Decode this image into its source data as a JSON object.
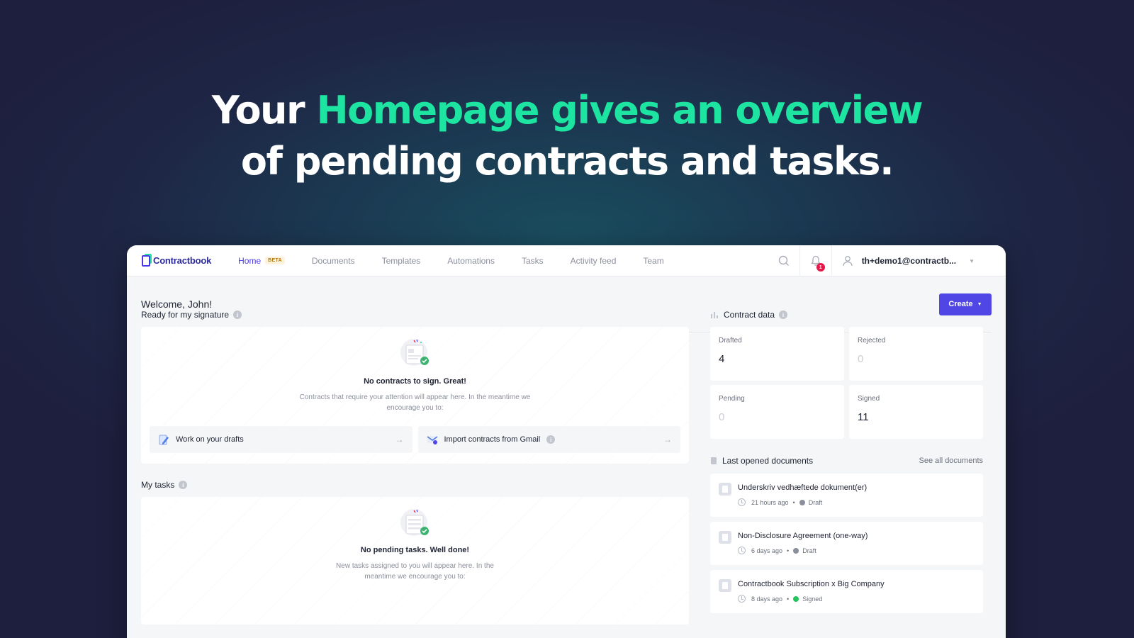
{
  "hero": {
    "line1_prefix": "Your ",
    "line1_accent": "Homepage gives an overview",
    "line2": "of pending contracts and tasks."
  },
  "navbar": {
    "logo": "Contractbook",
    "items": [
      {
        "label": "Home",
        "badge": "BETA",
        "active": true
      },
      {
        "label": "Documents"
      },
      {
        "label": "Templates"
      },
      {
        "label": "Automations"
      },
      {
        "label": "Tasks"
      },
      {
        "label": "Activity feed"
      },
      {
        "label": "Team"
      }
    ],
    "notification_count": "1",
    "user_email": "th+demo1@contractb..."
  },
  "header": {
    "welcome": "Welcome, John!",
    "create_label": "Create"
  },
  "signature": {
    "title": "Ready for my signature",
    "empty_title": "No contracts to sign. Great!",
    "empty_desc": "Contracts that require your attention will appear here. In the meantime we encourage you to:",
    "actions": [
      {
        "label": "Work on your drafts"
      },
      {
        "label": "Import contracts from Gmail"
      }
    ]
  },
  "tasks": {
    "title": "My tasks",
    "empty_title": "No pending tasks. Well done!",
    "empty_desc": "New tasks assigned to you will appear here. In the meantime we encourage you to:"
  },
  "contract_data": {
    "title": "Contract data",
    "stats": [
      {
        "label": "Drafted",
        "value": "4"
      },
      {
        "label": "Rejected",
        "value": "0"
      },
      {
        "label": "Pending",
        "value": "0"
      },
      {
        "label": "Signed",
        "value": "11"
      }
    ]
  },
  "documents": {
    "title": "Last opened documents",
    "see_all": "See all documents",
    "items": [
      {
        "title": "Underskriv vedhæftede dokument(er)",
        "time": "21 hours ago",
        "status": "Draft",
        "status_color": "#8b8f9c"
      },
      {
        "title": "Non-Disclosure Agreement (one-way)",
        "time": "6 days ago",
        "status": "Draft",
        "status_color": "#8b8f9c"
      },
      {
        "title": "Contractbook Subscription x Big Company",
        "time": "8 days ago",
        "status": "Signed",
        "status_color": "#22c55e"
      }
    ]
  },
  "colors": {
    "accent": "#1de4a0",
    "primary": "#4f46e5"
  }
}
